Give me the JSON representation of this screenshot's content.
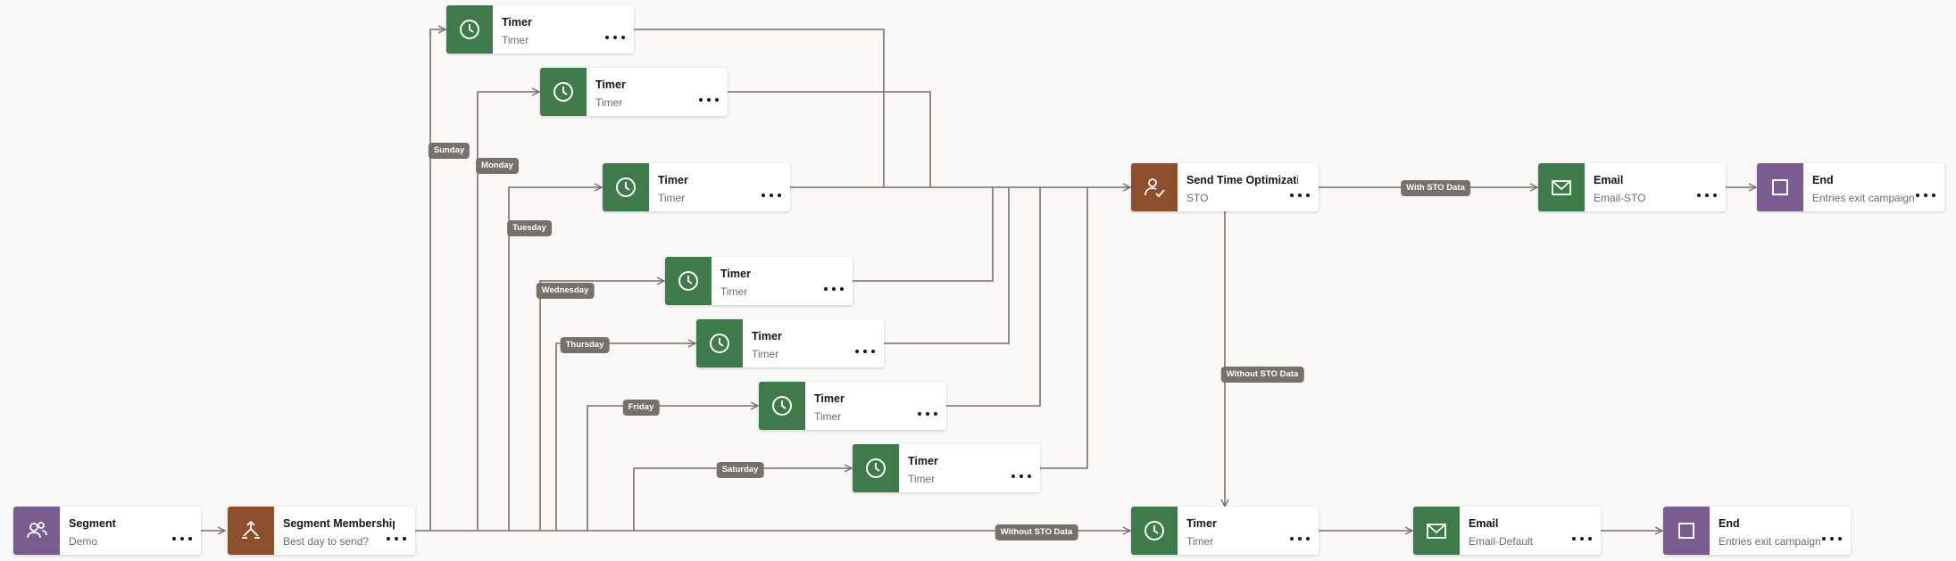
{
  "nodes": {
    "segment": {
      "title": "Segment",
      "subtitle": "Demo",
      "icon": "users-icon",
      "color": "#7b5c91"
    },
    "segment_membership": {
      "title": "Segment Membership",
      "subtitle": "Best day to send?",
      "icon": "split-icon",
      "color": "#8e4f2c"
    },
    "timer_sunday": {
      "title": "Timer",
      "subtitle": "Timer",
      "icon": "clock-icon",
      "color": "#3f7a4a"
    },
    "timer_monday": {
      "title": "Timer",
      "subtitle": "Timer",
      "icon": "clock-icon",
      "color": "#3f7a4a"
    },
    "timer_tuesday": {
      "title": "Timer",
      "subtitle": "Timer",
      "icon": "clock-icon",
      "color": "#3f7a4a"
    },
    "timer_wednesday": {
      "title": "Timer",
      "subtitle": "Timer",
      "icon": "clock-icon",
      "color": "#3f7a4a"
    },
    "timer_thursday": {
      "title": "Timer",
      "subtitle": "Timer",
      "icon": "clock-icon",
      "color": "#3f7a4a"
    },
    "timer_friday": {
      "title": "Timer",
      "subtitle": "Timer",
      "icon": "clock-icon",
      "color": "#3f7a4a"
    },
    "timer_saturday": {
      "title": "Timer",
      "subtitle": "Timer",
      "icon": "clock-icon",
      "color": "#3f7a4a"
    },
    "sto": {
      "title": "Send Time Optimization",
      "subtitle": "STO",
      "icon": "user-check-icon",
      "color": "#8e4f2c"
    },
    "email_sto": {
      "title": "Email",
      "subtitle": "Email-STO",
      "icon": "mail-icon",
      "color": "#3f7a4a"
    },
    "end_top": {
      "title": "End",
      "subtitle": "Entries exit campaign",
      "icon": "stop-square-icon",
      "color": "#7b5c91"
    },
    "timer_default": {
      "title": "Timer",
      "subtitle": "Timer",
      "icon": "clock-icon",
      "color": "#3f7a4a"
    },
    "email_default": {
      "title": "Email",
      "subtitle": "Email-Default",
      "icon": "mail-icon",
      "color": "#3f7a4a"
    },
    "end_bottom": {
      "title": "End",
      "subtitle": "Entries exit campaign",
      "icon": "stop-square-icon",
      "color": "#7b5c91"
    }
  },
  "labels": {
    "sunday": "Sunday",
    "monday": "Monday",
    "tuesday": "Tuesday",
    "wednesday": "Wednesday",
    "thursday": "Thursday",
    "friday": "Friday",
    "saturday": "Saturday",
    "with_sto": "With STO Data",
    "without_sto_vertical": "Without STO Data",
    "without_sto_horizontal": "Without STO Data"
  },
  "colors": {
    "connector": "#75716b",
    "label_bg": "#75716b",
    "canvas": "#f9f8f6"
  }
}
